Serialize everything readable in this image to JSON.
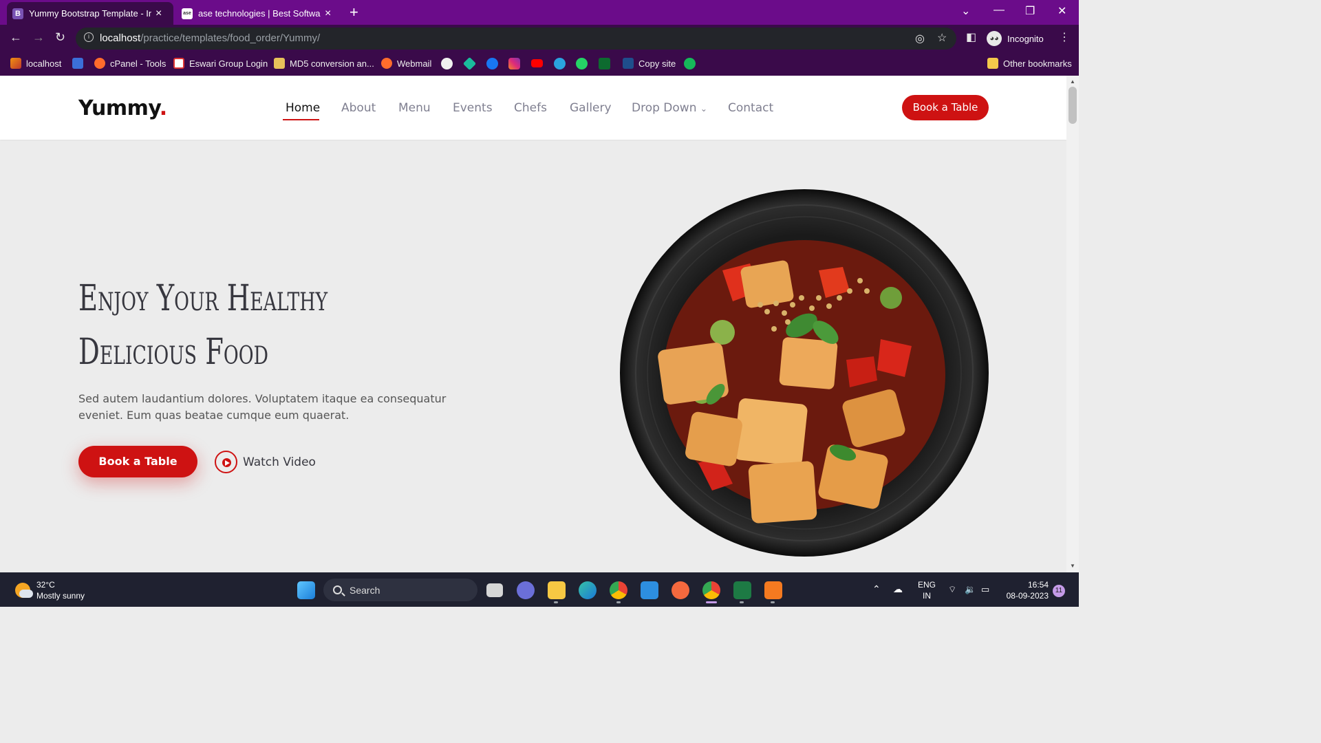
{
  "browser": {
    "tabs": [
      {
        "title": "Yummy Bootstrap Template - Ind",
        "favicon": "B",
        "active": true
      },
      {
        "title": "ase technologies | Best Software",
        "favicon": "ase",
        "active": false
      }
    ],
    "url_host": "localhost",
    "url_path": "/practice/templates/food_order/Yummy/",
    "profile": "Incognito",
    "bookmarks": [
      {
        "label": "localhost"
      },
      {
        "label": "cPanel - Tools"
      },
      {
        "label": "Eswari Group Login"
      },
      {
        "label": "MD5 conversion an..."
      },
      {
        "label": "Webmail"
      },
      {
        "label": "Copy site"
      }
    ],
    "other_bookmarks": "Other bookmarks"
  },
  "site": {
    "logo": "Yummy",
    "logo_dot": ".",
    "nav": [
      "Home",
      "About",
      "Menu",
      "Events",
      "Chefs",
      "Gallery",
      "Drop Down",
      "Contact"
    ],
    "header_cta": "Book a Table",
    "hero": {
      "title_line1": "Enjoy Your Healthy",
      "title_line2": "Delicious Food",
      "text_line1": "Sed autem laudantium dolores. Voluptatem itaque ea consequatur",
      "text_line2": "eveniet. Eum quas beatae cumque eum quaerat.",
      "primary_cta": "Book a Table",
      "secondary_cta": "Watch Video"
    },
    "accent_color": "#ce1212"
  },
  "taskbar": {
    "weather_temp": "32°C",
    "weather_desc": "Mostly sunny",
    "search_placeholder": "Search",
    "lang_top": "ENG",
    "lang_bottom": "IN",
    "time": "16:54",
    "date": "08-09-2023",
    "notifications": "11"
  }
}
